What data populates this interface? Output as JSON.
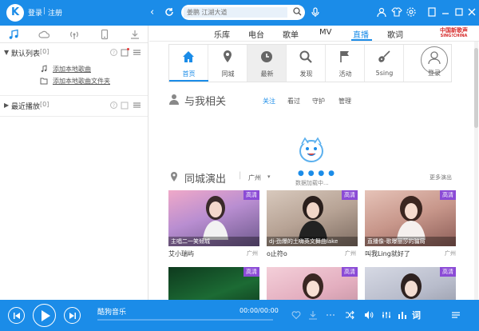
{
  "titlebar": {
    "logo": "K",
    "login": "登录",
    "separator": "|",
    "register": "注册",
    "search_placeholder": "姜鹏 江湖大道"
  },
  "sidebar": {
    "default_list": {
      "label": "默认列表",
      "count": "[0]"
    },
    "add_items": [
      {
        "label": "添加本地歌曲",
        "icon": "music-note-icon"
      },
      {
        "label": "添加本地歌曲文件夹",
        "icon": "folder-icon"
      }
    ],
    "recent_list": {
      "label": "最近播放",
      "count": "[0]"
    }
  },
  "main": {
    "tabs": [
      {
        "label": "乐库"
      },
      {
        "label": "电台"
      },
      {
        "label": "歌单"
      },
      {
        "label": "MV"
      },
      {
        "label": "直播"
      },
      {
        "label": "歌词"
      }
    ],
    "active_tab": "直播",
    "brand_badge_line1": "中国新歌声",
    "brand_badge_line2": "SING!CHINA",
    "sub_nav": [
      {
        "label": "首页",
        "icon": "home-icon"
      },
      {
        "label": "同城",
        "icon": "location-icon"
      },
      {
        "label": "最新",
        "icon": "clock-icon"
      },
      {
        "label": "发现",
        "icon": "search-icon"
      },
      {
        "label": "活动",
        "icon": "flag-icon"
      },
      {
        "label": "5sing",
        "icon": "guitar-icon"
      }
    ],
    "login_label": "登录",
    "related": {
      "title": "与我相关",
      "tabs": [
        "关注",
        "看过",
        "守护",
        "管理"
      ],
      "loading_dots": "● ● ● ●",
      "loading_text": "数据加载中..."
    },
    "city_section": {
      "title": "同城演出",
      "city": "广州",
      "more": "更多演出"
    },
    "cards": [
      {
        "badge": "高清",
        "caption": "主唱二一笑倾城",
        "name": "艾小瑞屿",
        "city": "广州"
      },
      {
        "badge": "高清",
        "caption": "dj-劲爆的土嗨英文舞曲lake",
        "name": "o止符o",
        "city": "广州"
      },
      {
        "badge": "高清",
        "caption": "直播像-歌曝丽莎的骗局",
        "name": "叫我Ling就好了",
        "city": "广州"
      },
      {
        "badge": "高清",
        "caption": "",
        "name": "",
        "city": ""
      },
      {
        "badge": "高清",
        "caption": "",
        "name": "",
        "city": ""
      },
      {
        "badge": "高清",
        "caption": "",
        "name": "",
        "city": ""
      }
    ]
  },
  "player": {
    "song": "酷狗音乐",
    "time": "00:00/00:00",
    "progress": 0,
    "lyric": "词"
  },
  "colors": {
    "accent": "#1b8ce8",
    "badge": "#8b4bd6"
  }
}
